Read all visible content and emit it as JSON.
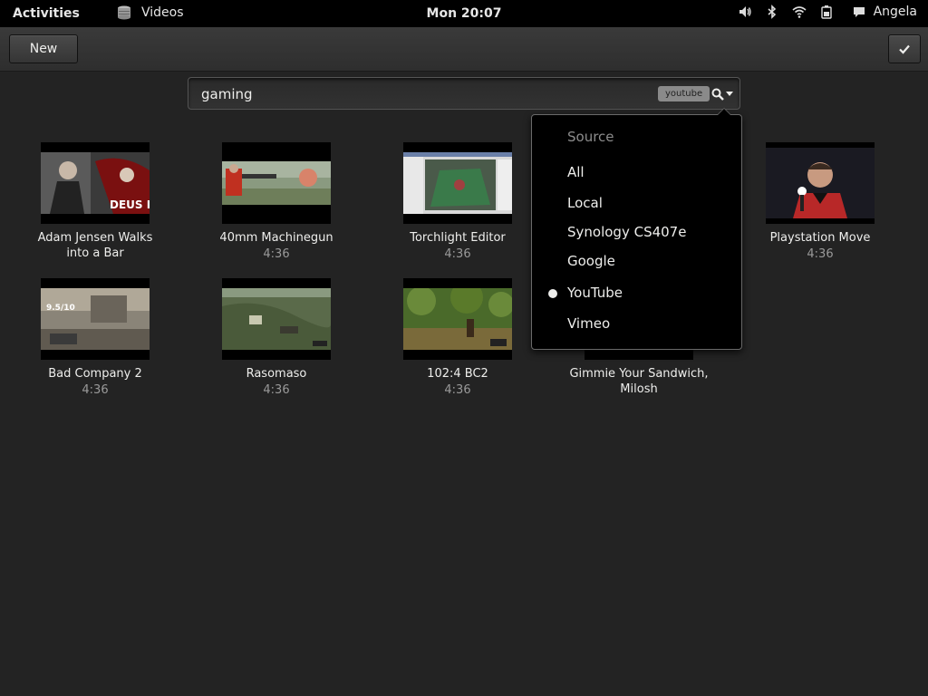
{
  "topbar": {
    "activities": "Activities",
    "app_name": "Videos",
    "clock": "Mon 20:07",
    "user": "Angela",
    "icons": [
      "video-app-icon",
      "volume-icon",
      "bluetooth-icon",
      "wifi-icon",
      "battery-icon",
      "chat-icon"
    ]
  },
  "header": {
    "new_label": "New",
    "check_icon": "checkmark-icon"
  },
  "search": {
    "value": "gaming",
    "source_tag": "youtube",
    "icon": "search-icon"
  },
  "videos": [
    {
      "title": "Adam Jensen Walks into a Bar",
      "duration": ""
    },
    {
      "title": "40mm Machinegun",
      "duration": "4:36"
    },
    {
      "title": "Torchlight Editor",
      "duration": "4:36"
    },
    {
      "title": "Playstation Move",
      "duration": "4:36"
    },
    {
      "title": "Bad Company 2",
      "duration": "4:36"
    },
    {
      "title": "Rasomaso",
      "duration": "4:36"
    },
    {
      "title": "102:4 BC2",
      "duration": "4:36"
    },
    {
      "title": "Gimmie Your Sandwich, Milosh",
      "duration": ""
    }
  ],
  "thumb_overlays": {
    "deus_ex": "DEUS EX",
    "score": "9.5/10"
  },
  "source_menu": {
    "heading": "Source",
    "options": [
      "All",
      "Local",
      "Synology CS407e",
      "Google",
      "YouTube",
      "Vimeo"
    ],
    "selected": "YouTube"
  },
  "colors": {
    "background": "#232323",
    "topbar": "#000000",
    "popover": "#000000",
    "text": "#eeeeec",
    "muted": "#9a9a9a"
  }
}
